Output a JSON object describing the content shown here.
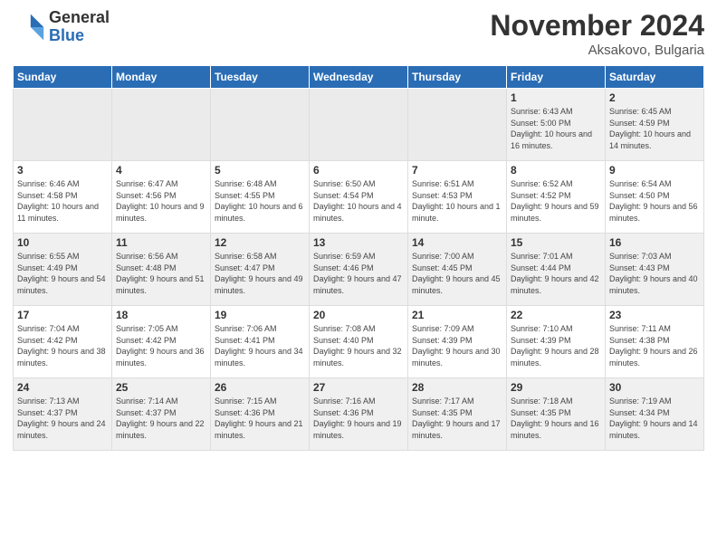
{
  "logo": {
    "general": "General",
    "blue": "Blue"
  },
  "header": {
    "month": "November 2024",
    "location": "Aksakovo, Bulgaria"
  },
  "weekdays": [
    "Sunday",
    "Monday",
    "Tuesday",
    "Wednesday",
    "Thursday",
    "Friday",
    "Saturday"
  ],
  "weeks": [
    [
      {
        "day": "",
        "info": ""
      },
      {
        "day": "",
        "info": ""
      },
      {
        "day": "",
        "info": ""
      },
      {
        "day": "",
        "info": ""
      },
      {
        "day": "",
        "info": ""
      },
      {
        "day": "1",
        "info": "Sunrise: 6:43 AM\nSunset: 5:00 PM\nDaylight: 10 hours and 16 minutes."
      },
      {
        "day": "2",
        "info": "Sunrise: 6:45 AM\nSunset: 4:59 PM\nDaylight: 10 hours and 14 minutes."
      }
    ],
    [
      {
        "day": "3",
        "info": "Sunrise: 6:46 AM\nSunset: 4:58 PM\nDaylight: 10 hours and 11 minutes."
      },
      {
        "day": "4",
        "info": "Sunrise: 6:47 AM\nSunset: 4:56 PM\nDaylight: 10 hours and 9 minutes."
      },
      {
        "day": "5",
        "info": "Sunrise: 6:48 AM\nSunset: 4:55 PM\nDaylight: 10 hours and 6 minutes."
      },
      {
        "day": "6",
        "info": "Sunrise: 6:50 AM\nSunset: 4:54 PM\nDaylight: 10 hours and 4 minutes."
      },
      {
        "day": "7",
        "info": "Sunrise: 6:51 AM\nSunset: 4:53 PM\nDaylight: 10 hours and 1 minute."
      },
      {
        "day": "8",
        "info": "Sunrise: 6:52 AM\nSunset: 4:52 PM\nDaylight: 9 hours and 59 minutes."
      },
      {
        "day": "9",
        "info": "Sunrise: 6:54 AM\nSunset: 4:50 PM\nDaylight: 9 hours and 56 minutes."
      }
    ],
    [
      {
        "day": "10",
        "info": "Sunrise: 6:55 AM\nSunset: 4:49 PM\nDaylight: 9 hours and 54 minutes."
      },
      {
        "day": "11",
        "info": "Sunrise: 6:56 AM\nSunset: 4:48 PM\nDaylight: 9 hours and 51 minutes."
      },
      {
        "day": "12",
        "info": "Sunrise: 6:58 AM\nSunset: 4:47 PM\nDaylight: 9 hours and 49 minutes."
      },
      {
        "day": "13",
        "info": "Sunrise: 6:59 AM\nSunset: 4:46 PM\nDaylight: 9 hours and 47 minutes."
      },
      {
        "day": "14",
        "info": "Sunrise: 7:00 AM\nSunset: 4:45 PM\nDaylight: 9 hours and 45 minutes."
      },
      {
        "day": "15",
        "info": "Sunrise: 7:01 AM\nSunset: 4:44 PM\nDaylight: 9 hours and 42 minutes."
      },
      {
        "day": "16",
        "info": "Sunrise: 7:03 AM\nSunset: 4:43 PM\nDaylight: 9 hours and 40 minutes."
      }
    ],
    [
      {
        "day": "17",
        "info": "Sunrise: 7:04 AM\nSunset: 4:42 PM\nDaylight: 9 hours and 38 minutes."
      },
      {
        "day": "18",
        "info": "Sunrise: 7:05 AM\nSunset: 4:42 PM\nDaylight: 9 hours and 36 minutes."
      },
      {
        "day": "19",
        "info": "Sunrise: 7:06 AM\nSunset: 4:41 PM\nDaylight: 9 hours and 34 minutes."
      },
      {
        "day": "20",
        "info": "Sunrise: 7:08 AM\nSunset: 4:40 PM\nDaylight: 9 hours and 32 minutes."
      },
      {
        "day": "21",
        "info": "Sunrise: 7:09 AM\nSunset: 4:39 PM\nDaylight: 9 hours and 30 minutes."
      },
      {
        "day": "22",
        "info": "Sunrise: 7:10 AM\nSunset: 4:39 PM\nDaylight: 9 hours and 28 minutes."
      },
      {
        "day": "23",
        "info": "Sunrise: 7:11 AM\nSunset: 4:38 PM\nDaylight: 9 hours and 26 minutes."
      }
    ],
    [
      {
        "day": "24",
        "info": "Sunrise: 7:13 AM\nSunset: 4:37 PM\nDaylight: 9 hours and 24 minutes."
      },
      {
        "day": "25",
        "info": "Sunrise: 7:14 AM\nSunset: 4:37 PM\nDaylight: 9 hours and 22 minutes."
      },
      {
        "day": "26",
        "info": "Sunrise: 7:15 AM\nSunset: 4:36 PM\nDaylight: 9 hours and 21 minutes."
      },
      {
        "day": "27",
        "info": "Sunrise: 7:16 AM\nSunset: 4:36 PM\nDaylight: 9 hours and 19 minutes."
      },
      {
        "day": "28",
        "info": "Sunrise: 7:17 AM\nSunset: 4:35 PM\nDaylight: 9 hours and 17 minutes."
      },
      {
        "day": "29",
        "info": "Sunrise: 7:18 AM\nSunset: 4:35 PM\nDaylight: 9 hours and 16 minutes."
      },
      {
        "day": "30",
        "info": "Sunrise: 7:19 AM\nSunset: 4:34 PM\nDaylight: 9 hours and 14 minutes."
      }
    ]
  ]
}
